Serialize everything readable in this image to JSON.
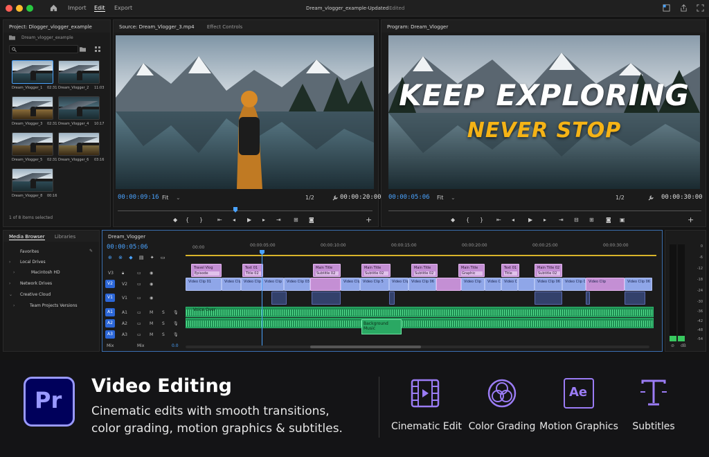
{
  "titlebar": {
    "menu_import": "Import",
    "menu_edit": "Edit",
    "menu_export": "Export",
    "doc_title": "Dream_vlogger_example-Updated",
    "doc_state": "Edited"
  },
  "project": {
    "title": "Project: Dlogger_vlogger_example",
    "folder": "Dream_vlogger_example",
    "clips": [
      {
        "name": "Dream_Vlogger_1",
        "dur": "02:31"
      },
      {
        "name": "Dream_Vlogger_2",
        "dur": "11:03"
      },
      {
        "name": "Dream_Vlogger_3",
        "dur": "02:31"
      },
      {
        "name": "Dream_Vlogger_4",
        "dur": "10:17"
      },
      {
        "name": "Dream_Vlogger_5",
        "dur": "02:31"
      },
      {
        "name": "Dream_Vlogger_6",
        "dur": "03:16"
      },
      {
        "name": "Dream_Vlogger_8",
        "dur": "00:16"
      }
    ],
    "selection": "1 of 8 items selected"
  },
  "source": {
    "tab": "Source: Dream_Vlogger_3.mp4",
    "tab2": "Effect Controls",
    "timecode": "00:00:09:16",
    "fit": "Fit",
    "res": "1/2",
    "duration": "00:00:20:00"
  },
  "program": {
    "tab": "Program: Dream_Vlogger",
    "title_line1": "KEEP EXPLORING",
    "title_line2": "NEVER STOP",
    "timecode": "00:00:05:06",
    "fit": "Fit",
    "res": "1/2",
    "duration": "00:00:30:00"
  },
  "media": {
    "tab1": "Media Browser",
    "tab2": "Libraries",
    "items": [
      "Favorites",
      "Local Drives",
      "Macintosh HD",
      "Network Drives",
      "Creative Cloud",
      "Team Projects Versions"
    ]
  },
  "timeline": {
    "name": "Dream_Vlogger",
    "timecode": "00:00:05:06",
    "ruler": [
      "00:00",
      "00:00:05:00",
      "00:00:10:00",
      "00:00:15:00",
      "00:00:20:00",
      "00:00:25:00",
      "00:00:30:00"
    ],
    "tracks": [
      "V3",
      "V2",
      "V1",
      "A1",
      "A2",
      "A3"
    ],
    "mix_label": "Mix",
    "mix_value": "0.0",
    "v3_clips": [
      {
        "a": "Travel Vlog",
        "b": "Episode"
      },
      {
        "a": "Text 01",
        "b": "Title 02"
      },
      {
        "a": "Main Title",
        "b": "Subtitle 02"
      },
      {
        "a": "Main Title",
        "b": "Subtitle 02"
      },
      {
        "a": "Main Title",
        "b": "Subtitle 02"
      },
      {
        "a": "Main Title",
        "b": "Graphic"
      },
      {
        "a": "Text 01",
        "b": "Title"
      },
      {
        "a": "Main Title 02",
        "b": "Subtitle 02"
      }
    ],
    "v2_clips": [
      "Video Clip 01",
      "Video Clip 02",
      "Video Clip 03",
      "Video Clip 03",
      "Video Clip 03",
      "Video Clip",
      "Video Clip 5",
      "Video Clip",
      "Video Clip 06",
      "Video Clip",
      "Video Clip",
      "Video Clip",
      "Video Clip 06",
      "Video Clip 06",
      "Video Clip",
      "Video Clip 06"
    ],
    "a1_label": "Voice Over",
    "a3_label": "Background Music"
  },
  "meter": {
    "scale": [
      "0",
      "-6",
      "-12",
      "-18",
      "-24",
      "-30",
      "-36",
      "-42",
      "-48",
      "-54"
    ],
    "db": "dB"
  },
  "promo": {
    "logo": "Pr",
    "heading": "Video Editing",
    "line1": "Cinematic edits with smooth transitions,",
    "line2": "color grading, motion graphics & subtitles.",
    "features": [
      "Cinematic Edit",
      "Color Grading",
      "Motion Graphics",
      "Subtitles"
    ],
    "ae_text": "Ae"
  },
  "colors": {
    "accent_blue": "#4aa3ff",
    "premiere_purple": "#9999ff",
    "title_yellow": "#f5b316",
    "audio_green": "#1f8f53"
  }
}
